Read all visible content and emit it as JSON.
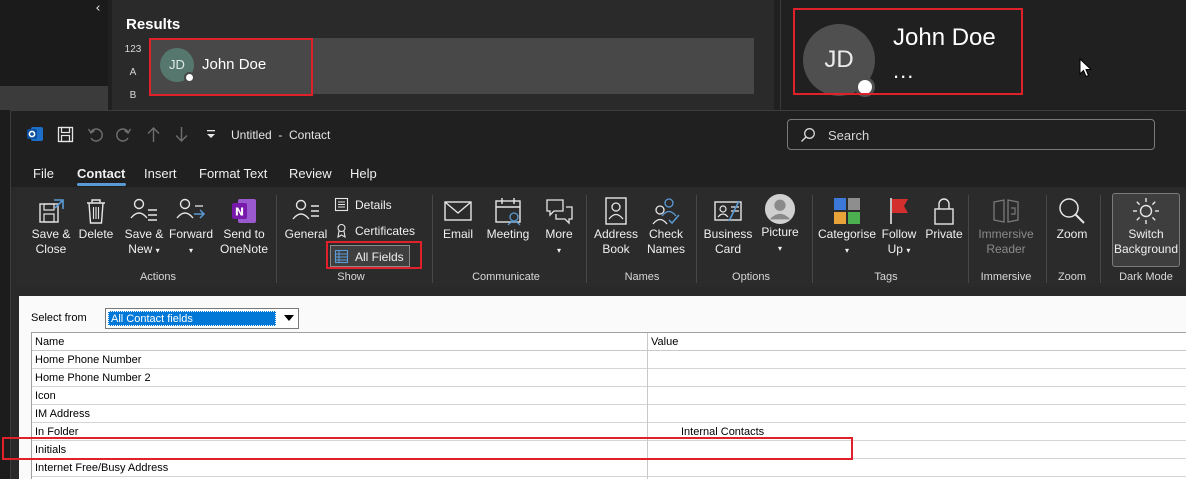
{
  "people_search": {
    "results_title": "Results",
    "index_letters": [
      "123",
      "A",
      "B"
    ],
    "result": {
      "initials": "JD",
      "name": "John Doe"
    }
  },
  "contact_card": {
    "initials": "JD",
    "name": "John Doe",
    "more": "..."
  },
  "window": {
    "title": "Untitled  -  Contact",
    "search_placeholder": "Search"
  },
  "menu": {
    "tabs": [
      {
        "label": "File"
      },
      {
        "label": "Contact",
        "active": true
      },
      {
        "label": "Insert"
      },
      {
        "label": "Format Text"
      },
      {
        "label": "Review"
      },
      {
        "label": "Help"
      }
    ]
  },
  "ribbon": {
    "actions": {
      "group_label": "Actions",
      "save_close": "Save &\nClose",
      "delete": "Delete",
      "save_new": "Save &\nNew",
      "forward": "Forward",
      "send_onenote": "Send to\nOneNote"
    },
    "show": {
      "group_label": "Show",
      "general": "General",
      "details": "Details",
      "certificates": "Certificates",
      "all_fields": "All Fields"
    },
    "communicate": {
      "group_label": "Communicate",
      "email": "Email",
      "meeting": "Meeting",
      "more": "More"
    },
    "names": {
      "group_label": "Names",
      "address_book": "Address\nBook",
      "check_names": "Check\nNames"
    },
    "options": {
      "group_label": "Options",
      "business_card": "Business\nCard",
      "picture": "Picture"
    },
    "tags": {
      "group_label": "Tags",
      "categorise": "Categorise",
      "follow_up": "Follow\nUp",
      "private": "Private"
    },
    "immersive": {
      "group_label": "Immersive",
      "immersive_reader": "Immersive\nReader"
    },
    "zoom": {
      "group_label": "Zoom",
      "zoom": "Zoom"
    },
    "dark_mode": {
      "group_label": "Dark Mode",
      "switch_background": "Switch\nBackground"
    }
  },
  "fields": {
    "select_from_label": "Select from",
    "select_value": "All Contact fields",
    "columns": {
      "name": "Name",
      "value": "Value"
    },
    "rows": [
      {
        "name": "Home Phone Number",
        "value": ""
      },
      {
        "name": "Home Phone Number 2",
        "value": ""
      },
      {
        "name": "Icon",
        "value": ""
      },
      {
        "name": "IM Address",
        "value": ""
      },
      {
        "name": "In Folder",
        "value": "Internal Contacts"
      },
      {
        "name": "Initials",
        "value": ""
      },
      {
        "name": "Internet Free/Busy Address",
        "value": ""
      }
    ]
  },
  "colors": {
    "accent": "#5b9bd5",
    "highlight": "#e0202a",
    "selection": "#0078d7"
  }
}
